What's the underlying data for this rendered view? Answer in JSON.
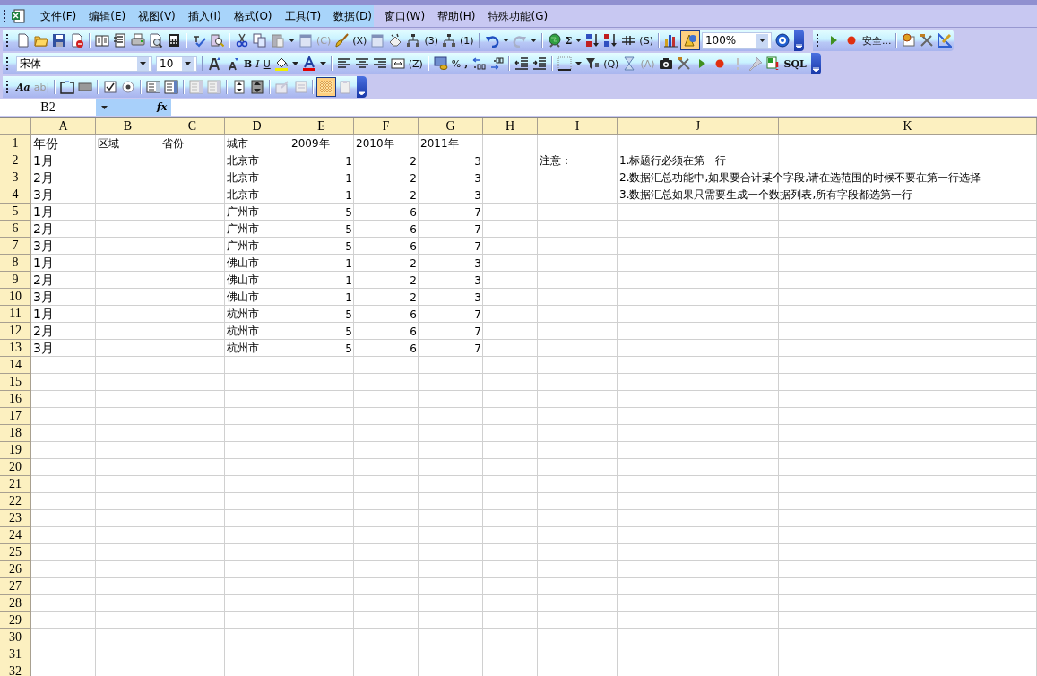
{
  "menu_bar": {
    "items": [
      "文件(F)",
      "编辑(E)",
      "视图(V)",
      "插入(I)",
      "格式(O)",
      "工具(T)",
      "数据(D)",
      "窗口(W)",
      "帮助(H)",
      "特殊功能(G)"
    ]
  },
  "standard_toolbar": {
    "labels": [
      "(C)",
      "(X)",
      "(3)",
      "(1)",
      "Σ",
      "(S)"
    ],
    "zoom": "100%",
    "drawing_on": true
  },
  "macro_toolbar": {
    "labels": [
      "安全..."
    ]
  },
  "formatting_toolbar": {
    "font": "宋体",
    "size": "10",
    "labels": [
      "B",
      "I",
      "U",
      "(Z)",
      "%",
      ",",
      "(Q)",
      "(A)",
      "SQL"
    ]
  },
  "forms_toolbar": {
    "labels": [
      "Aa",
      "ab|"
    ],
    "grid_on": true
  },
  "formula_bar": {
    "name_box": "B2",
    "function_label": "fx"
  },
  "sheet": {
    "columns": [
      "A",
      "B",
      "C",
      "D",
      "E",
      "F",
      "G",
      "H",
      "I",
      "J",
      "K"
    ],
    "rows": [
      {
        "number": "1",
        "cells": {
          "A": {
            "text": "年份",
            "kind": "large"
          },
          "B": {
            "text": "区域",
            "kind": "text"
          },
          "C": {
            "text": "省份",
            "kind": "text"
          },
          "D": {
            "text": "城市",
            "kind": "text"
          },
          "E": {
            "text": "2009年",
            "kind": "text"
          },
          "F": {
            "text": "2010年",
            "kind": "text"
          },
          "G": {
            "text": "2011年",
            "kind": "text"
          }
        }
      },
      {
        "number": "2",
        "cells": {
          "A": {
            "text": "1月",
            "kind": "large"
          },
          "D": {
            "text": "北京市",
            "kind": "text"
          },
          "E": {
            "text": "1",
            "kind": "number"
          },
          "F": {
            "text": "2",
            "kind": "number"
          },
          "G": {
            "text": "3",
            "kind": "number"
          },
          "I": {
            "text": "注意：",
            "kind": "text"
          },
          "J": {
            "text": "1.标题行必须在第一行",
            "kind": "text"
          }
        }
      },
      {
        "number": "3",
        "cells": {
          "A": {
            "text": "2月",
            "kind": "large"
          },
          "D": {
            "text": "北京市",
            "kind": "text"
          },
          "E": {
            "text": "1",
            "kind": "number"
          },
          "F": {
            "text": "2",
            "kind": "number"
          },
          "G": {
            "text": "3",
            "kind": "number"
          },
          "J": {
            "text": "2.数据汇总功能中,如果要合计某个字段,请在选范围的时候不要在第一行选择",
            "kind": "text"
          }
        }
      },
      {
        "number": "4",
        "cells": {
          "A": {
            "text": "3月",
            "kind": "large"
          },
          "D": {
            "text": "北京市",
            "kind": "text"
          },
          "E": {
            "text": "1",
            "kind": "number"
          },
          "F": {
            "text": "2",
            "kind": "number"
          },
          "G": {
            "text": "3",
            "kind": "number"
          },
          "J": {
            "text": "3.数据汇总如果只需要生成一个数据列表,所有字段都选第一行",
            "kind": "text"
          }
        }
      },
      {
        "number": "5",
        "cells": {
          "A": {
            "text": "1月",
            "kind": "large"
          },
          "D": {
            "text": "广州市",
            "kind": "text"
          },
          "E": {
            "text": "5",
            "kind": "number"
          },
          "F": {
            "text": "6",
            "kind": "number"
          },
          "G": {
            "text": "7",
            "kind": "number"
          }
        }
      },
      {
        "number": "6",
        "cells": {
          "A": {
            "text": "2月",
            "kind": "large"
          },
          "D": {
            "text": "广州市",
            "kind": "text"
          },
          "E": {
            "text": "5",
            "kind": "number"
          },
          "F": {
            "text": "6",
            "kind": "number"
          },
          "G": {
            "text": "7",
            "kind": "number"
          }
        }
      },
      {
        "number": "7",
        "cells": {
          "A": {
            "text": "3月",
            "kind": "large"
          },
          "D": {
            "text": "广州市",
            "kind": "text"
          },
          "E": {
            "text": "5",
            "kind": "number"
          },
          "F": {
            "text": "6",
            "kind": "number"
          },
          "G": {
            "text": "7",
            "kind": "number"
          }
        }
      },
      {
        "number": "8",
        "cells": {
          "A": {
            "text": "1月",
            "kind": "large"
          },
          "D": {
            "text": "佛山市",
            "kind": "text"
          },
          "E": {
            "text": "1",
            "kind": "number"
          },
          "F": {
            "text": "2",
            "kind": "number"
          },
          "G": {
            "text": "3",
            "kind": "number"
          }
        }
      },
      {
        "number": "9",
        "cells": {
          "A": {
            "text": "2月",
            "kind": "large"
          },
          "D": {
            "text": "佛山市",
            "kind": "text"
          },
          "E": {
            "text": "1",
            "kind": "number"
          },
          "F": {
            "text": "2",
            "kind": "number"
          },
          "G": {
            "text": "3",
            "kind": "number"
          }
        }
      },
      {
        "number": "10",
        "cells": {
          "A": {
            "text": "3月",
            "kind": "large"
          },
          "D": {
            "text": "佛山市",
            "kind": "text"
          },
          "E": {
            "text": "1",
            "kind": "number"
          },
          "F": {
            "text": "2",
            "kind": "number"
          },
          "G": {
            "text": "3",
            "kind": "number"
          }
        }
      },
      {
        "number": "11",
        "cells": {
          "A": {
            "text": "1月",
            "kind": "large"
          },
          "D": {
            "text": "杭州市",
            "kind": "text"
          },
          "E": {
            "text": "5",
            "kind": "number"
          },
          "F": {
            "text": "6",
            "kind": "number"
          },
          "G": {
            "text": "7",
            "kind": "number"
          }
        }
      },
      {
        "number": "12",
        "cells": {
          "A": {
            "text": "2月",
            "kind": "large"
          },
          "D": {
            "text": "杭州市",
            "kind": "text"
          },
          "E": {
            "text": "5",
            "kind": "number"
          },
          "F": {
            "text": "6",
            "kind": "number"
          },
          "G": {
            "text": "7",
            "kind": "number"
          }
        }
      },
      {
        "number": "13",
        "cells": {
          "A": {
            "text": "3月",
            "kind": "large"
          },
          "D": {
            "text": "杭州市",
            "kind": "text"
          },
          "E": {
            "text": "5",
            "kind": "number"
          },
          "F": {
            "text": "6",
            "kind": "number"
          },
          "G": {
            "text": "7",
            "kind": "number"
          }
        }
      },
      {
        "number": "14"
      },
      {
        "number": "15"
      },
      {
        "number": "16"
      },
      {
        "number": "17"
      },
      {
        "number": "18"
      },
      {
        "number": "19"
      },
      {
        "number": "20"
      },
      {
        "number": "21"
      },
      {
        "number": "22"
      },
      {
        "number": "23"
      },
      {
        "number": "24"
      },
      {
        "number": "25"
      },
      {
        "number": "26"
      },
      {
        "number": "27"
      },
      {
        "number": "28"
      },
      {
        "number": "29"
      },
      {
        "number": "30"
      },
      {
        "number": "31"
      },
      {
        "number": "32"
      }
    ]
  }
}
